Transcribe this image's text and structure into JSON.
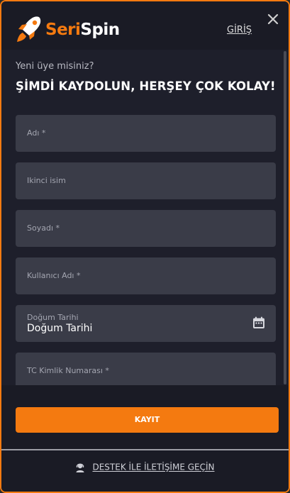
{
  "brand": {
    "name_part1": "Seri",
    "name_part2": "Spin",
    "accent": "#f47a10"
  },
  "header": {
    "login_label": "GİRİŞ",
    "close_icon": "close-icon"
  },
  "intro": {
    "question": "Yeni üye misiniz?",
    "headline": "ŞİMDİ KAYDOLUN, HERŞEY ÇOK KOLAY!"
  },
  "form": {
    "fields": [
      {
        "placeholder": "Adı *"
      },
      {
        "placeholder": "Ikinci isim"
      },
      {
        "placeholder": "Soyadı *"
      },
      {
        "placeholder": "Kullanıcı Adı *"
      },
      {
        "label": "Doğum Tarihi",
        "value": "Doğum Tarihi",
        "icon": "calendar-icon"
      },
      {
        "placeholder": "TC Kimlik Numarası *"
      }
    ]
  },
  "footer": {
    "register_label": "KAYIT",
    "support_label": "DESTEK İLE İLETİŞİME GEÇİN",
    "support_icon": "support-agent-icon"
  }
}
